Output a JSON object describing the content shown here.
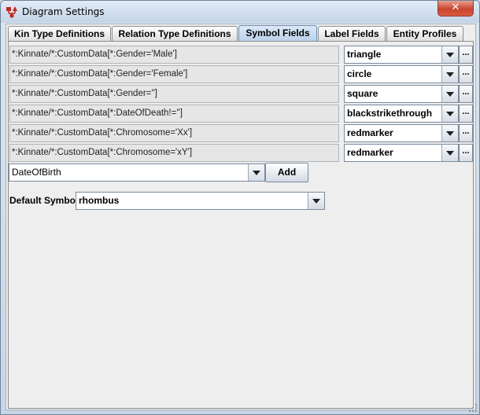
{
  "window": {
    "title": "Diagram Settings",
    "close_glyph": "✕"
  },
  "tabs": [
    {
      "label": "Kin Type Definitions"
    },
    {
      "label": "Relation Type Definitions"
    },
    {
      "label": "Symbol Fields",
      "selected": true
    },
    {
      "label": "Label Fields"
    },
    {
      "label": "Entity Profiles"
    }
  ],
  "symbol_rows": [
    {
      "path": "*:Kinnate/*:CustomData[*:Gender='Male']",
      "symbol": "triangle"
    },
    {
      "path": "*:Kinnate/*:CustomData[*:Gender='Female']",
      "symbol": "circle"
    },
    {
      "path": "*:Kinnate/*:CustomData[*:Gender='']",
      "symbol": "square"
    },
    {
      "path": "*:Kinnate/*:CustomData[*:DateOfDeath!='']",
      "symbol": "blackstrikethrough"
    },
    {
      "path": "*:Kinnate/*:CustomData[*:Chromosome='Xx']",
      "symbol": "redmarker"
    },
    {
      "path": "*:Kinnate/*:CustomData[*:Chromosome='xY']",
      "symbol": "redmarker"
    }
  ],
  "browse_label": "...",
  "add_field": {
    "value": "DateOfBirth",
    "button_label": "Add"
  },
  "default_symbol": {
    "label": "Default Symbol",
    "value": "rhombus"
  },
  "icons": {
    "app": "kinship-diagram-icon",
    "dropdown": "chevron-down-icon",
    "resize": "resize-grip-icon"
  }
}
